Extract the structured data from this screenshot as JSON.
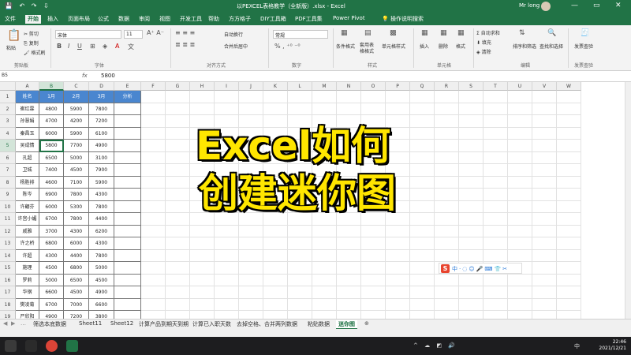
{
  "titlebar": {
    "qat": "💾 ↶ ↷ ⇩",
    "document": "以PEXCEL表格教学（全新版）.xlsx - Excel",
    "user": "Mr long",
    "buttons": [
      "—",
      "▭",
      "✕"
    ]
  },
  "ribbon_tabs": [
    "文件",
    "开始",
    "插入",
    "页面布局",
    "公式",
    "数据",
    "审阅",
    "视图",
    "开发工具",
    "帮助",
    "方方格子",
    "DIY工具箱",
    "PDF工具集",
    "Power Pivot"
  ],
  "tell_me": "💡 操作说明搜索",
  "ribbon": {
    "clipboard": {
      "paste": "粘贴",
      "cut": "✂ 剪切",
      "copy": "⎘ 复制",
      "format_painter": "🖌 格式刷",
      "group": "剪贴板"
    },
    "font": {
      "name": "宋体",
      "size": "11",
      "group": "字体"
    },
    "alignment": {
      "wrap": "自动换行",
      "merge": "合并后居中",
      "group": "对齐方式"
    },
    "number": {
      "format": "常规",
      "group": "数字"
    },
    "styles": {
      "conditional": "条件格式",
      "table": "套用表格格式",
      "cell": "单元格样式",
      "group": "样式"
    },
    "cells": {
      "insert": "插入",
      "delete": "删除",
      "format": "格式",
      "group": "单元格"
    },
    "editing": {
      "autosum": "Σ 自动求和",
      "fill": "⬇ 填充",
      "clear": "◈ 清除",
      "sort": "排序和筛选",
      "find": "查找和选择",
      "group": "编辑"
    },
    "send": {
      "label": "发票查验",
      "group": "发票查验"
    }
  },
  "formula_bar": {
    "name_box": "B5",
    "fx": "fx",
    "value": "5800"
  },
  "columns": [
    "A",
    "B",
    "C",
    "D",
    "E",
    "F",
    "G",
    "H",
    "I",
    "J",
    "K",
    "L",
    "M",
    "N",
    "O",
    "P",
    "Q",
    "R",
    "S",
    "T",
    "U",
    "V",
    "W"
  ],
  "selected_column": "B",
  "rows": [
    "1",
    "2",
    "3",
    "4",
    "5",
    "6",
    "7",
    "8",
    "9",
    "10",
    "11",
    "12",
    "13",
    "14",
    "15",
    "16",
    "17",
    "18",
    "19"
  ],
  "selected_row": "5",
  "table": {
    "headers": [
      "姓名",
      "1月",
      "2月",
      "3月",
      "分析"
    ],
    "data": [
      [
        "崔红霖",
        "4800",
        "5900",
        "7800"
      ],
      [
        "孙慧娟",
        "4700",
        "4200",
        "7200"
      ],
      [
        "秦昌玉",
        "6000",
        "5900",
        "6100"
      ],
      [
        "吴成情",
        "5800",
        "7700",
        "4900"
      ],
      [
        "孔超",
        "6500",
        "5000",
        "3100"
      ],
      [
        "卫城",
        "7400",
        "4500",
        "7900"
      ],
      [
        "杨胜排",
        "4600",
        "7100",
        "5900"
      ],
      [
        "陈岑",
        "6900",
        "7800",
        "4300"
      ],
      [
        "许翩芬",
        "6000",
        "5300",
        "7800"
      ],
      [
        "许宫小媚",
        "6700",
        "7800",
        "4400"
      ],
      [
        "戚雅",
        "3700",
        "4300",
        "6200"
      ],
      [
        "许之桥",
        "6800",
        "6000",
        "4300"
      ],
      [
        "许超",
        "4300",
        "4400",
        "7800"
      ],
      [
        "施理",
        "4500",
        "6800",
        "5000"
      ],
      [
        "罗莉",
        "5000",
        "6500",
        "4500"
      ],
      [
        "华钢",
        "6600",
        "4500",
        "4900"
      ],
      [
        "樊凌菊",
        "6700",
        "7000",
        "6600"
      ],
      [
        "严欣阳",
        "4900",
        "7200",
        "3800"
      ]
    ]
  },
  "overlay": {
    "line1": "Excel如何",
    "line2": "创建迷你图"
  },
  "ime": {
    "logo": "S",
    "tools": "中·◌☺🎤⌨👕✂"
  },
  "sheet_nav": [
    "◀",
    "▶",
    "…"
  ],
  "sheet_tabs": [
    "筛选本底数据",
    "Sheet11",
    "Sheet12",
    "计算产品到期天到期",
    "计算已入职天数",
    "去掉空格、合并两列数据",
    "粘贴数据",
    "迷你图"
  ],
  "active_sheet": "迷你图",
  "add_sheet": "⊕",
  "taskbar": {
    "time": "22:46",
    "date": "2021/12/21",
    "lang": "中",
    "tray": "^ ☁ ◩ 🔊"
  },
  "colors": {
    "excel_green": "#217346",
    "header_blue": "#4a86cf",
    "overlay_yellow": "#ffe600"
  }
}
